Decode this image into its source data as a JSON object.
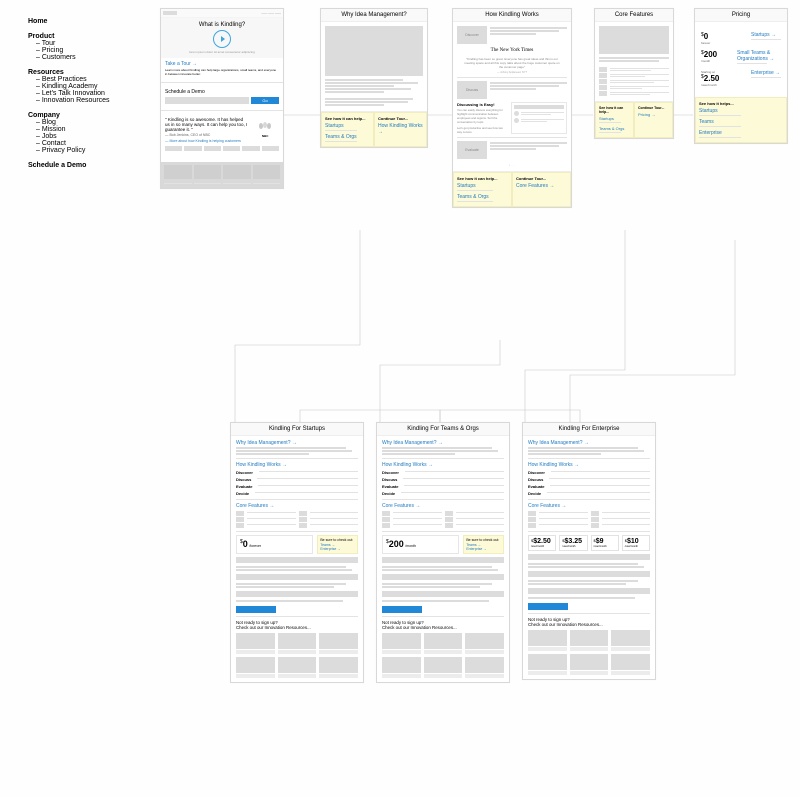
{
  "sitemap": {
    "home": "Home",
    "product": "Product",
    "product_items": [
      "Tour",
      "Pricing",
      "Customers"
    ],
    "resources": "Resources",
    "resources_items": [
      "Best Practices",
      "Kindling Academy",
      "Let's Talk Innovation",
      "Innovation Resources"
    ],
    "company": "Company",
    "company_items": [
      "Blog",
      "Mission",
      "Jobs",
      "Contact",
      "Privacy Policy"
    ],
    "schedule": "Schedule a Demo"
  },
  "home_panel": {
    "headline": "What is Kindling?",
    "take_tour": "Take a Tour →",
    "take_tour_sub": "Learn more about Kindling can help large organizations, small teams, and everyone in between innovate better.",
    "schedule": "Schedule a Demo",
    "go": "Go",
    "quote": "\" Kindling is so awesome. It has helped us in so many ways. It can help you too, I guarantee it. \"",
    "quote_cite": "— Bob Jenkins, CEO of NBC",
    "quote_more": "— More about how Kindling is helping customers"
  },
  "why": {
    "title": "Why Idea Management?",
    "see_label": "See how it can help...",
    "continue_label": "Continue Tour...",
    "startups": "Startups",
    "teams": "Teams & Orgs",
    "continue_link": "How Kindling Works →"
  },
  "how": {
    "title": "How Kindling Works",
    "discover": "Discover",
    "nyt": "The New York Times",
    "discuss": "Discuss",
    "discussing": "Discussing is Easy!",
    "evaluate": "Evaluate",
    "see_label": "See how it can help...",
    "continue_label": "Continue Tour...",
    "startups": "Startups",
    "teams": "Teams & Orgs",
    "continue_link": "Core Features →"
  },
  "core": {
    "title": "Core Features",
    "see_label": "See how it can help...",
    "continue_label": "Continue Tour...",
    "startups": "Startups",
    "teams": "Teams & Orgs",
    "continue_link": "Pricing →"
  },
  "pricing": {
    "title": "Pricing",
    "p0_amount": "$0",
    "p0_sub": "forever",
    "p0_plan": "Startups →",
    "p1_amount": "$200",
    "p1_sub": "/month",
    "p1_plan": "Small Teams & Organizations →",
    "p2_pre": "Starting at",
    "p2_amount": "$2.50",
    "p2_sub": "/user/month",
    "p2_plan": "Enterprise →",
    "see_label": "See how it helps...",
    "startups": "Startups",
    "teams": "Teams",
    "enterprise": "Enterprise"
  },
  "detail": {
    "startups_title": "Kindling For Startups",
    "teams_title": "Kindling For Teams & Orgs",
    "enterprise_title": "Kindling For Enterprise",
    "why_link": "Why Idea Management? →",
    "how_link": "How Kindling Works →",
    "discover": "Discover",
    "discuss": "Discuss",
    "evaluate": "Evaluate",
    "decide": "Decide",
    "core_link": "Core Features →",
    "be_sure": "Be sure to check out:",
    "be_sure_teams": "Teams →",
    "be_sure_ent": "Enterprise →",
    "startups_price_amount": "$0",
    "startups_price_sub": "/forever",
    "teams_price_amount": "$200",
    "teams_price_sub": "/month",
    "ent_p0": "$2.50",
    "ent_p1": "$3.25",
    "ent_p2": "$9",
    "ent_p3": "$10",
    "ent_psub": "/user/month",
    "not_ready_1": "Not ready to sign up?",
    "not_ready_2": "Check out our Innovation Resources..."
  }
}
